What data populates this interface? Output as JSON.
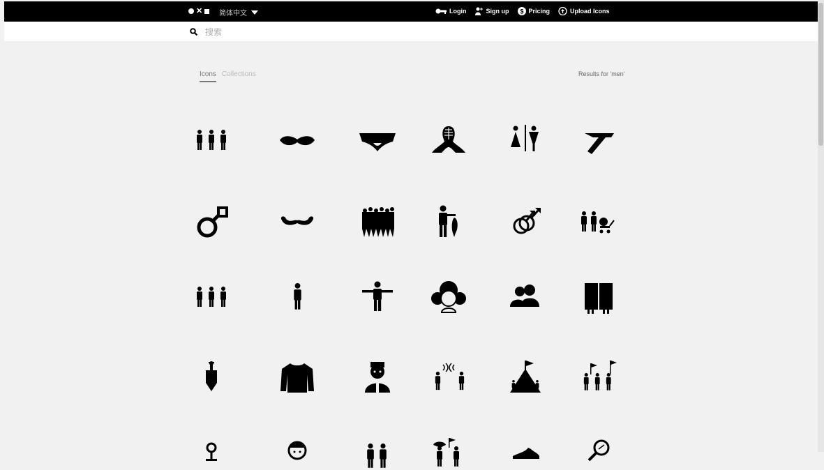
{
  "header": {
    "language": "简体中文",
    "links": [
      {
        "label": "Login",
        "icon": "key-icon"
      },
      {
        "label": "Sign up",
        "icon": "user-plus-icon"
      },
      {
        "label": "Pricing",
        "icon": "dollar-icon"
      },
      {
        "label": "Upload Icons",
        "icon": "upload-icon"
      }
    ]
  },
  "search": {
    "placeholder": "搜索"
  },
  "tabs": [
    {
      "label": "Icons",
      "active": true
    },
    {
      "label": "Collections",
      "active": false
    }
  ],
  "results_label": "Results for 'men'",
  "icons": [
    "three-men-icon",
    "mustache-icon",
    "underwear-icon",
    "kendo-armor-icon",
    "restroom-sign-icon",
    "razor-icon",
    "male-symbol-icon",
    "curly-mustache-icon",
    "crowd-icon",
    "man-with-fish-icon",
    "double-male-symbol-icon",
    "two-men-with-stroller-icon",
    "three-men-icon",
    "standing-man-icon",
    "man-arms-out-icon",
    "three-faces-icon",
    "two-heads-icon",
    "men-behind-curtain-icon",
    "urinal-icon",
    "sweater-icon",
    "guard-man-icon",
    "men-with-signal-icon",
    "climbers-with-flag-icon",
    "protesters-with-flags-icon",
    "person-pin-icon",
    "face-icon",
    "two-men-icon",
    "man-with-flag-icon",
    "shoe-icon",
    "magnifier-icon"
  ]
}
